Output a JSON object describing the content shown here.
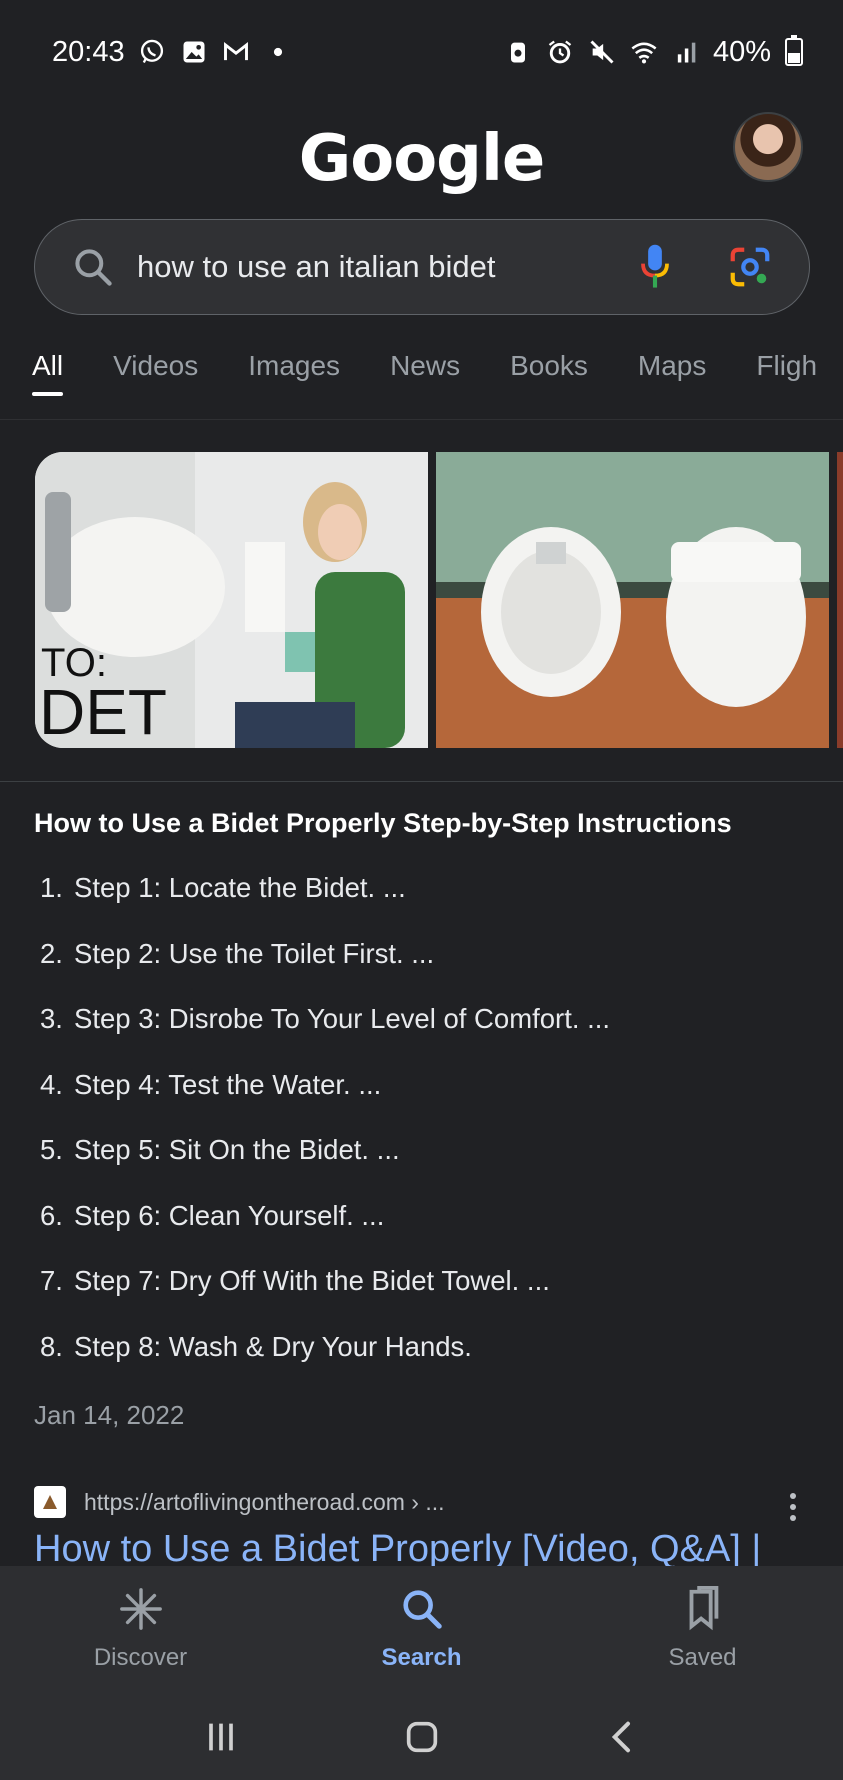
{
  "status_bar": {
    "time": "20:43",
    "left_icons": [
      "whatsapp-icon",
      "gallery-icon",
      "gmail-icon",
      "dot-icon"
    ],
    "right_icons": [
      "saver-icon",
      "alarm-icon",
      "mute-icon",
      "wifi-icon",
      "signal-icon"
    ],
    "battery_percent": "40%",
    "battery_level": 0.4
  },
  "header": {
    "logo_text": "Google",
    "avatar": "profile-avatar"
  },
  "search": {
    "query": "how to use an italian bidet",
    "icons": [
      "search-icon",
      "microphone-icon",
      "google-lens-icon"
    ]
  },
  "tabs": [
    {
      "label": "All",
      "active": true
    },
    {
      "label": "Videos"
    },
    {
      "label": "Images"
    },
    {
      "label": "News"
    },
    {
      "label": "Books"
    },
    {
      "label": "Maps"
    },
    {
      "label": "Fligh"
    }
  ],
  "carousel": {
    "image1_text": "TO:\nDET"
  },
  "snippet": {
    "title": "How to Use a Bidet Properly Step-by-Step Instructions",
    "steps": [
      {
        "num": "1.",
        "text": "Step 1: Locate the Bidet. ..."
      },
      {
        "num": "2.",
        "text": "Step 2: Use the Toilet First. ..."
      },
      {
        "num": "3.",
        "text": "Step 3: Disrobe To Your Level of Comfort. ..."
      },
      {
        "num": "4.",
        "text": "Step 4: Test the Water. ..."
      },
      {
        "num": "5.",
        "text": "Step 5: Sit On the Bidet. ..."
      },
      {
        "num": "6.",
        "text": "Step 6: Clean Yourself. ..."
      },
      {
        "num": "7.",
        "text": "Step 7: Dry Off With the Bidet Towel. ..."
      },
      {
        "num": "8.",
        "text": "Step 8: Wash & Dry Your Hands."
      }
    ],
    "date": "Jan 14, 2022"
  },
  "result": {
    "url": "https://artoflivingontheroad.com › ...",
    "title": "How to Use a Bidet Properly [Video, Q&A] |"
  },
  "bottom_nav": [
    {
      "label": "Discover",
      "icon": "discover-icon"
    },
    {
      "label": "Search",
      "icon": "search-icon",
      "active": true
    },
    {
      "label": "Saved",
      "icon": "bookmark-icon"
    }
  ],
  "system_nav": [
    "recents-icon",
    "home-icon",
    "back-icon"
  ],
  "colors": {
    "background": "#202124",
    "link": "#8ab4f8",
    "accent_active": "#8ab4f8"
  }
}
